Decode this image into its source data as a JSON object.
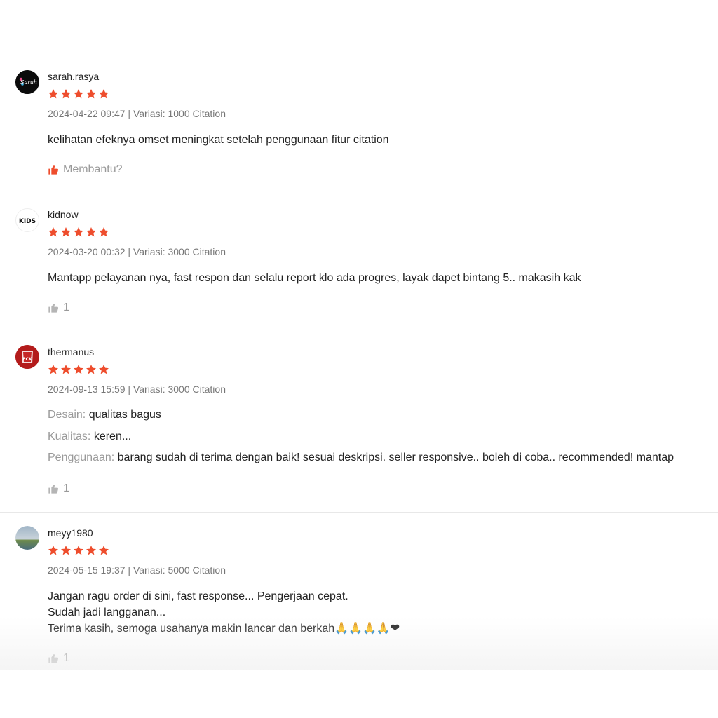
{
  "colors": {
    "star": "#ee4d2d",
    "helpful_active": "#ee4d2d",
    "helpful_inactive": "#b5b5b5"
  },
  "reviews": [
    {
      "username": "sarah.rasya",
      "rating": 5,
      "meta": "2024-04-22 09:47 | Variasi: 1000 Citation",
      "lines": [
        "kelihatan efeknya omset meningkat setelah penggunaan fitur citation"
      ],
      "helpful_label": "Membantu?",
      "helpful_active": true,
      "avatar_text": "Sarah"
    },
    {
      "username": "kidnow",
      "rating": 5,
      "meta": "2024-03-20 00:32 | Variasi: 3000 Citation",
      "lines": [
        "Mantapp pelayanan nya, fast respon dan selalu report klo ada progres, layak dapet bintang 5.. makasih kak"
      ],
      "helpful_label": "1",
      "helpful_active": false,
      "avatar_text": "KIDS"
    },
    {
      "username": "thermanus",
      "rating": 5,
      "meta": "2024-09-13 15:59 | Variasi: 3000 Citation",
      "attributes": [
        {
          "label": "Desain:",
          "value": "qualitas bagus"
        },
        {
          "label": "Kualitas:",
          "value": "keren..."
        },
        {
          "label": "Penggunaan:",
          "value": "barang sudah di terima dengan baik! sesuai deskripsi. seller responsive.. boleh di coba.. recommended! mantap"
        }
      ],
      "helpful_label": "1",
      "helpful_active": false,
      "avatar_text": "FCK"
    },
    {
      "username": "meyy1980",
      "rating": 5,
      "meta": "2024-05-15 19:37 | Variasi: 5000 Citation",
      "lines": [
        "Jangan ragu order di sini, fast response... Pengerjaan cepat.",
        "Sudah jadi langganan...",
        "Terima kasih, semoga usahanya makin lancar dan berkah🙏🙏🙏🙏❤"
      ],
      "helpful_label": "1",
      "helpful_active": false
    }
  ]
}
